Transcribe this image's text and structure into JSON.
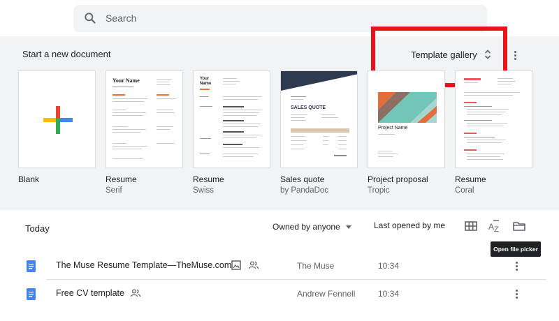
{
  "search": {
    "placeholder": "Search"
  },
  "template_band": {
    "title": "Start a new document",
    "gallery_label": "Template gallery",
    "templates": [
      {
        "name": "Blank",
        "subtitle": ""
      },
      {
        "name": "Resume",
        "subtitle": "Serif",
        "thumb_heading": "Your Name"
      },
      {
        "name": "Resume",
        "subtitle": "Swiss",
        "thumb_heading": "Your Name"
      },
      {
        "name": "Sales quote",
        "subtitle": "by PandaDoc",
        "thumb_heading": "SALES QUOTE"
      },
      {
        "name": "Project proposal",
        "subtitle": "Tropic",
        "thumb_heading": "Project Name"
      },
      {
        "name": "Resume",
        "subtitle": "Coral",
        "thumb_heading": ""
      }
    ]
  },
  "docs": {
    "section_title": "Today",
    "owner_filter": "Owned by anyone",
    "sort_label": "Last opened by me",
    "tooltip": "Open file picker",
    "rows": [
      {
        "title": "The Muse Resume Template—TheMuse.com",
        "owner": "The Muse",
        "time": "10:34"
      },
      {
        "title": "Free CV template",
        "owner": "Andrew Fennell",
        "time": "10:34"
      }
    ]
  },
  "colors": {
    "highlight": "#e8131b",
    "doc_blue": "#4285f4",
    "band": "#f1f3f4"
  }
}
